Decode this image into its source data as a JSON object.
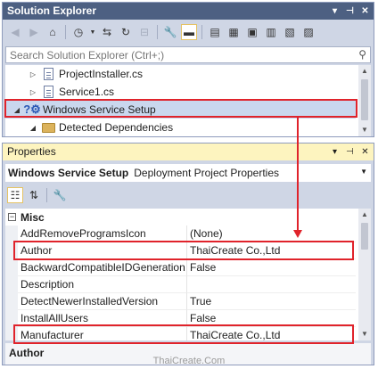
{
  "solution_explorer": {
    "title": "Solution Explorer",
    "title_controls": [
      "chevron-down-icon",
      "pin-icon",
      "close-icon"
    ],
    "search_placeholder": "Search Solution Explorer (Ctrl+;)",
    "tree": [
      {
        "label": "ProjectInstaller.cs",
        "expander": "collapsed",
        "icon": "cs-file-icon"
      },
      {
        "label": "Service1.cs",
        "expander": "collapsed",
        "icon": "cs-file-icon"
      },
      {
        "label": "Windows Service Setup",
        "expander": "expanded",
        "icon": "setup-project-icon",
        "selected": true
      },
      {
        "label": "Detected Dependencies",
        "expander": "expanded",
        "icon": "folder-icon"
      }
    ]
  },
  "properties": {
    "title": "Properties",
    "object_name": "Windows Service Setup",
    "object_type": "Deployment Project Properties",
    "category": "Misc",
    "rows": [
      {
        "name": "AddRemoveProgramsIcon",
        "value": "(None)"
      },
      {
        "name": "Author",
        "value": "ThaiCreate Co.,Ltd",
        "highlighted": true
      },
      {
        "name": "BackwardCompatibleIDGeneration",
        "value": "False"
      },
      {
        "name": "Description",
        "value": ""
      },
      {
        "name": "DetectNewerInstalledVersion",
        "value": "True"
      },
      {
        "name": "InstallAllUsers",
        "value": "False"
      },
      {
        "name": "Manufacturer",
        "value": "ThaiCreate Co.,Ltd",
        "highlighted": true
      }
    ],
    "description_title": "Author"
  },
  "watermark": "ThaiCreate.Com",
  "colors": {
    "title_active": "#4d6082",
    "title_inactive": "#fdf4bf",
    "annotation": "#e0232b"
  }
}
